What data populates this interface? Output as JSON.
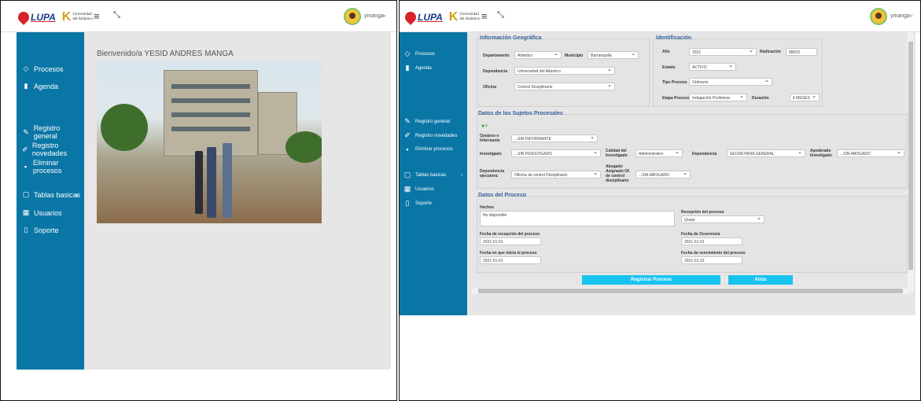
{
  "brand": {
    "logo_text": "LUPA",
    "university": "Universidad del Atlántico"
  },
  "user": {
    "name": "ymanga"
  },
  "sidebar": {
    "items": [
      {
        "label": "Procesos",
        "icon": "diamond-icon"
      },
      {
        "label": "Agenda",
        "icon": "book-icon"
      },
      {
        "label": "Registro general",
        "icon": "edit-icon"
      },
      {
        "label": "Registro novedades",
        "icon": "pencil-icon"
      },
      {
        "label": "Eliminar procesos",
        "icon": "trash-icon"
      },
      {
        "label": "Tablas basicas",
        "icon": "file-icon"
      },
      {
        "label": "Usuarios",
        "icon": "table-icon"
      },
      {
        "label": "Soporte",
        "icon": "doc-icon"
      }
    ]
  },
  "home": {
    "welcome": "Bienvenido/a YESID ANDRES MANGA"
  },
  "form": {
    "geo": {
      "legend": "Información Geográfica",
      "departamento_label": "Departamento",
      "departamento": "Atlántico",
      "municipio_label": "Municipio",
      "municipio": "Barranquilla",
      "dependencia_label": "Dependencia",
      "dependencia": "Universidad del Atlántico",
      "oficina_label": "Oficina",
      "oficina": "Control Disciplinario"
    },
    "ident": {
      "legend": "Identificación",
      "anio_label": "Año",
      "anio": "2021",
      "radicacion_label": "Radicación",
      "radicacion": "88003",
      "estado_label": "Estado",
      "estado": "ACTIVO",
      "tipo_label": "Tipo Proceso",
      "tipo": "Ordinario",
      "etapa_label": "Etapa Proceso",
      "etapa": "Indagación Preliminar",
      "duracion_label": "Duración",
      "duracion": "6 MESES"
    },
    "sujetos": {
      "legend": "Datos de los Sujetos Procesales",
      "quejoso_label": "Quejoso o Informante",
      "quejoso": "...SIN INFORMANTE",
      "investigado_label": "Investigado",
      "investigado": "...SIN INVESTIGADO",
      "calidad_label": "Calidad del Investigado",
      "calidad": "Administrativo",
      "dependencia_label": "Dependencia",
      "dependencia": "SECRETARIA GENERAL",
      "apoderado_label": "Apoderado Investigado",
      "apoderado": "...SIN ABOGADO",
      "dep_ejec_label": "Dependencia ejecutora:",
      "dep_ejec": "Oficina de control Disciplinario",
      "abogado_label": "Abogado Asignado Of. de control disciplinario",
      "abogado": "...SIN ABOGADO"
    },
    "proceso": {
      "legend": "Datos del Proceso",
      "hechos_label": "Hechos",
      "hechos": "No disponible",
      "recepcion_label": "Recepción del proceso",
      "recepcion": "Queja",
      "fecha_recepcion_label": "Fecha de recepción del proceso",
      "fecha_recepcion": "2021-01-01",
      "fecha_ocurrencia_label": "Fecha de Ocurrencia",
      "fecha_ocurrencia": "2021-01-01",
      "fecha_inicio_label": "Fecha en que inicia el proceso",
      "fecha_inicio": "2021-01-01",
      "fecha_vencimiento_label": "Fecha de vencimiento del proceso",
      "fecha_vencimiento": "2021-01-22"
    },
    "buttons": {
      "register": "Registrar Proceso",
      "back": "Atrás"
    }
  }
}
